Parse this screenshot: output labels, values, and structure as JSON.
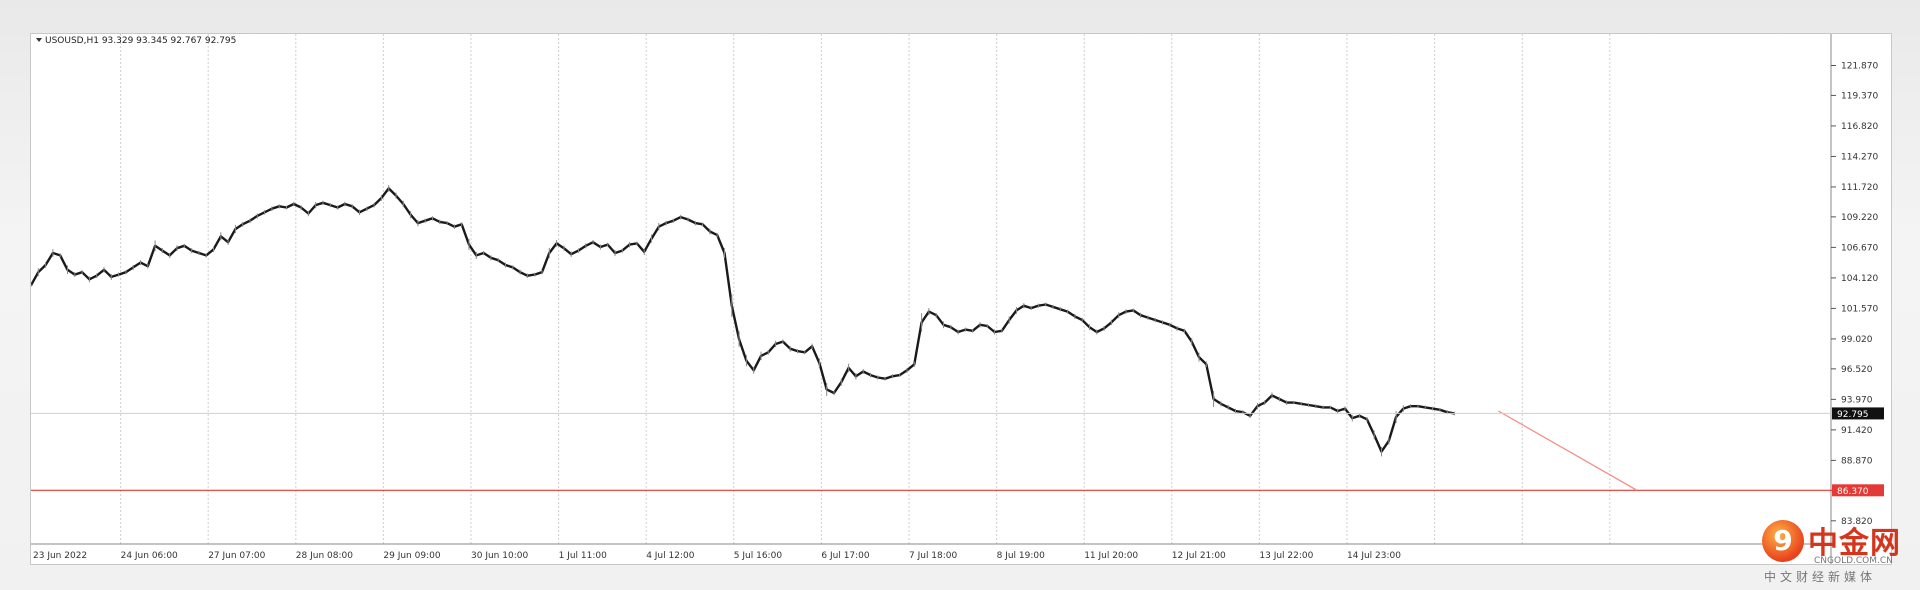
{
  "symbol_label": "USOUSD,H1  93.329 93.345 92.767 92.795",
  "logo": {
    "name": "中金网",
    "domain": "CNGOLD.COM.CN",
    "tagline": "中文财经新媒体",
    "mark": "9"
  },
  "chart_data": {
    "type": "line",
    "title": "",
    "xlabel": "",
    "ylabel": "",
    "ylim": [
      82.3,
      123.5
    ],
    "grid": {
      "vertical": true,
      "horizontal": false
    },
    "x_ticks": [
      "23 Jun 2022",
      "24 Jun 06:00",
      "27 Jun 07:00",
      "28 Jun 08:00",
      "29 Jun 09:00",
      "30 Jun 10:00",
      "1 Jul 11:00",
      "4 Jul 12:00",
      "5 Jul 16:00",
      "6 Jul 17:00",
      "7 Jul 18:00",
      "8 Jul 19:00",
      "11 Jul 20:00",
      "12 Jul 21:00",
      "13 Jul 22:00",
      "14 Jul 23:00"
    ],
    "y_ticks": [
      121.87,
      119.37,
      116.82,
      114.27,
      111.72,
      109.22,
      106.67,
      104.12,
      101.57,
      99.02,
      96.52,
      93.97,
      91.42,
      88.87,
      86.37,
      83.82
    ],
    "current_price": {
      "value": 92.795,
      "label": "92.795"
    },
    "support_line": {
      "value": 86.37,
      "label": "86.370",
      "color": "#e53935"
    },
    "price_color": "#1a1a1a",
    "projection": {
      "color": "#f28b82",
      "from": {
        "index": 201,
        "value": 93.0
      },
      "to": {
        "index": 220,
        "value": 86.37
      }
    },
    "series": [
      {
        "values": [
          103.5,
          104.6,
          105.2,
          106.2,
          106.0,
          104.8,
          104.4,
          104.6,
          104.0,
          104.3,
          104.8,
          104.2,
          104.4,
          104.6,
          105.0,
          105.4,
          105.1,
          106.8,
          106.4,
          106.0,
          106.6,
          106.8,
          106.4,
          106.2,
          106.0,
          106.5,
          107.6,
          107.1,
          108.2,
          108.6,
          108.9,
          109.3,
          109.6,
          109.9,
          110.1,
          110.0,
          110.3,
          110.0,
          109.5,
          110.2,
          110.4,
          110.2,
          110.0,
          110.3,
          110.1,
          109.6,
          109.9,
          110.2,
          110.8,
          111.6,
          111.0,
          110.3,
          109.4,
          108.7,
          108.9,
          109.1,
          108.8,
          108.7,
          108.4,
          108.6,
          106.9,
          106.0,
          106.2,
          105.8,
          105.6,
          105.2,
          105.0,
          104.6,
          104.3,
          104.4,
          104.6,
          106.2,
          107.0,
          106.6,
          106.1,
          106.4,
          106.8,
          107.1,
          106.7,
          106.9,
          106.2,
          106.4,
          106.9,
          107.0,
          106.3,
          107.4,
          108.4,
          108.7,
          108.9,
          109.2,
          109.0,
          108.7,
          108.6,
          108.0,
          107.7,
          106.2,
          101.8,
          99.0,
          97.2,
          96.4,
          97.6,
          97.9,
          98.6,
          98.8,
          98.2,
          98.0,
          97.9,
          98.4,
          97.0,
          94.8,
          94.5,
          95.4,
          96.6,
          95.9,
          96.3,
          96.0,
          95.8,
          95.7,
          95.9,
          96.0,
          96.4,
          96.9,
          100.4,
          101.3,
          101.0,
          100.2,
          100.0,
          99.6,
          99.8,
          99.7,
          100.2,
          100.1,
          99.6,
          99.7,
          100.6,
          101.4,
          101.8,
          101.6,
          101.8,
          101.9,
          101.7,
          101.5,
          101.3,
          100.9,
          100.6,
          100.0,
          99.6,
          99.9,
          100.4,
          101.0,
          101.3,
          101.4,
          101.0,
          100.8,
          100.6,
          100.4,
          100.2,
          99.9,
          99.7,
          98.8,
          97.5,
          96.9,
          94.0,
          93.6,
          93.3,
          93.0,
          92.9,
          92.6,
          93.4,
          93.7,
          94.3,
          94.0,
          93.7,
          93.7,
          93.6,
          93.5,
          93.4,
          93.3,
          93.3,
          93.0,
          93.2,
          92.4,
          92.6,
          92.3,
          91.0,
          89.6,
          90.5,
          92.5,
          93.2,
          93.4,
          93.4,
          93.3,
          93.2,
          93.1,
          92.9,
          92.795
        ]
      }
    ]
  }
}
